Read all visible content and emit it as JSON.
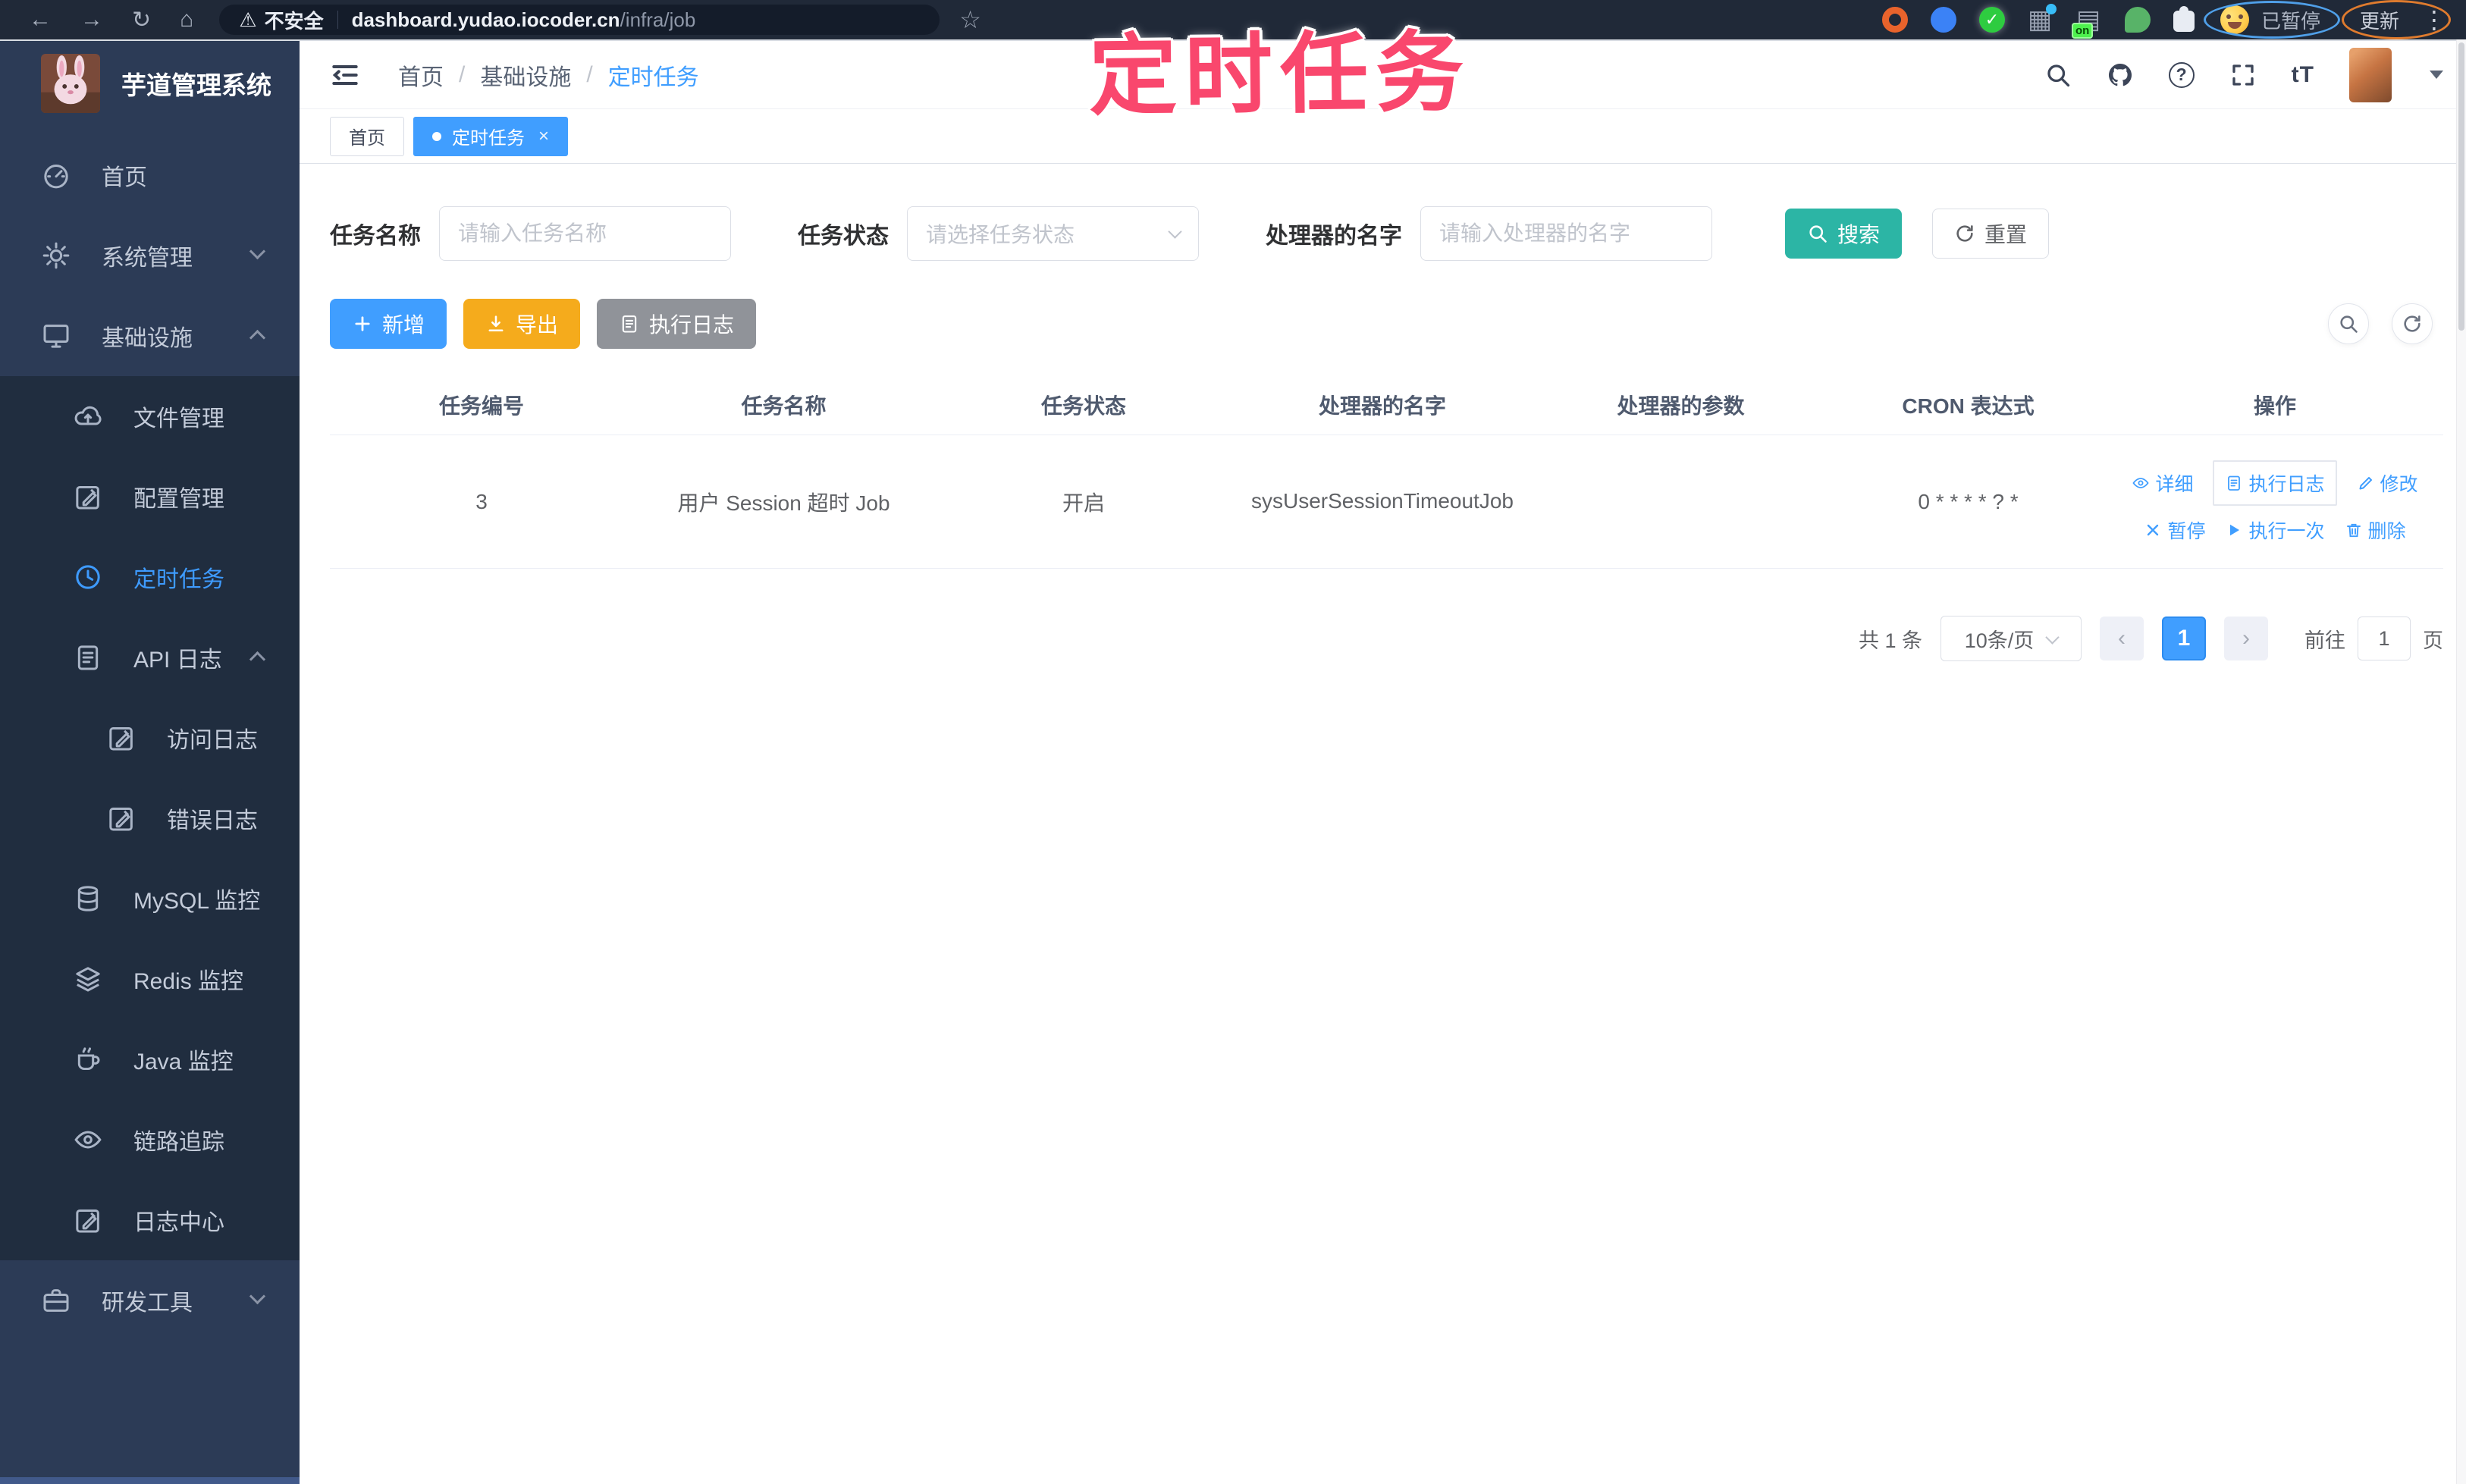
{
  "browser": {
    "security_label": "不安全",
    "url_domain": "dashboard.yudao.iocoder.cn",
    "url_path": "/infra/job",
    "extension_badge": "on",
    "paused_label": "已暂停",
    "update_label": "更新"
  },
  "annotation": {
    "text": "定时任务",
    "color": "#f9476d"
  },
  "sidebar": {
    "logo_title": "芋道管理系统",
    "items": [
      {
        "label": "首页",
        "icon": "gauge-icon",
        "level": 1
      },
      {
        "label": "系统管理",
        "icon": "gear-icon",
        "level": 1,
        "chevron": "down"
      },
      {
        "label": "基础设施",
        "icon": "monitor-icon",
        "level": 1,
        "chevron": "up"
      },
      {
        "label": "文件管理",
        "icon": "cloud-upload-icon",
        "level": 2
      },
      {
        "label": "配置管理",
        "icon": "edit-square-icon",
        "level": 2
      },
      {
        "label": "定时任务",
        "icon": "clock-icon",
        "level": 2,
        "active": true
      },
      {
        "label": "API 日志",
        "icon": "log-doc-icon",
        "level": 2,
        "chevron": "up"
      },
      {
        "label": "访问日志",
        "icon": "edit-square-icon",
        "level": 3
      },
      {
        "label": "错误日志",
        "icon": "edit-square-icon",
        "level": 3
      },
      {
        "label": "MySQL 监控",
        "icon": "database-icon",
        "level": 2
      },
      {
        "label": "Redis 监控",
        "icon": "layers-icon",
        "level": 2
      },
      {
        "label": "Java 监控",
        "icon": "coffee-icon",
        "level": 2
      },
      {
        "label": "链路追踪",
        "icon": "eye-icon",
        "level": 2
      },
      {
        "label": "日志中心",
        "icon": "edit-square-icon",
        "level": 2
      },
      {
        "label": "研发工具",
        "icon": "briefcase-icon",
        "level": 1,
        "chevron": "down"
      }
    ]
  },
  "header": {
    "breadcrumb": [
      "首页",
      "基础设施",
      "定时任务"
    ],
    "separator": "/",
    "icons": [
      "search-icon",
      "github-icon",
      "help-icon",
      "fullscreen-icon",
      "font-size-icon",
      "avatar",
      "dropdown-caret"
    ]
  },
  "tabs": [
    {
      "label": "首页",
      "active": false
    },
    {
      "label": "定时任务",
      "active": true,
      "closable": true
    }
  ],
  "filters": {
    "name_label": "任务名称",
    "name_placeholder": "请输入任务名称",
    "status_label": "任务状态",
    "status_placeholder": "请选择任务状态",
    "handler_label": "处理器的名字",
    "handler_placeholder": "请输入处理器的名字",
    "search_label": "搜索",
    "reset_label": "重置"
  },
  "toolbar": {
    "add_label": "新增",
    "export_label": "导出",
    "exec_log_label": "执行日志"
  },
  "table": {
    "headers": [
      "任务编号",
      "任务名称",
      "任务状态",
      "处理器的名字",
      "处理器的参数",
      "CRON 表达式",
      "操作"
    ],
    "rows": [
      {
        "id": "3",
        "name": "用户 Session 超时 Job",
        "status": "开启",
        "handler": "sysUserSessionTimeoutJob",
        "param": "",
        "cron": "0 * * * * ? *",
        "actions": [
          "详细",
          "执行日志",
          "修改",
          "暂停",
          "执行一次",
          "删除"
        ]
      }
    ]
  },
  "pagination": {
    "total": "共 1 条",
    "page_size": "10条/页",
    "current_page": "1",
    "goto_label": "前往",
    "goto_value": "1",
    "page_unit": "页"
  },
  "colors": {
    "primary": "#409eff",
    "search_teal": "#2cb5a5",
    "export_orange": "#f5ab1c",
    "info_gray": "#909399",
    "sidebar_bg": "#2c3b56",
    "submenu_bg": "#202d3f",
    "annotation_pink": "#f9476d"
  }
}
